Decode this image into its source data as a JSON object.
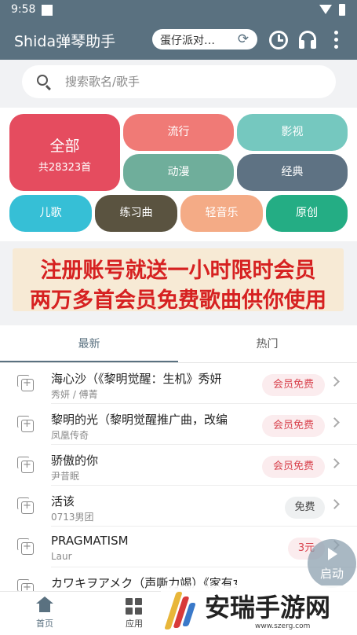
{
  "status_bar": {
    "time": "9:58"
  },
  "app_bar": {
    "title": "Shida弹琴助手",
    "current_song": "蛋仔派对…"
  },
  "search": {
    "placeholder": "搜索歌名/歌手"
  },
  "categories": {
    "all": {
      "label": "全部",
      "count": "共28323首"
    },
    "items": [
      {
        "label": "流行",
        "color": "#f07a76"
      },
      {
        "label": "影视",
        "color": "#75c8bf"
      },
      {
        "label": "动漫",
        "color": "#6fae9b"
      },
      {
        "label": "经典",
        "color": "#5e7283"
      },
      {
        "label": "儿歌",
        "color": "#36bfd6"
      },
      {
        "label": "练习曲",
        "color": "#5a5340"
      },
      {
        "label": "轻音乐",
        "color": "#f4ab86"
      },
      {
        "label": "原创",
        "color": "#24ad84"
      }
    ]
  },
  "banner": {
    "line1": "注册账号就送一小时限时会员",
    "line2": "两万多首会员免费歌曲供你使用"
  },
  "tabs": {
    "latest": "最新",
    "hot": "热门"
  },
  "songs": [
    {
      "name": "海心沙（《黎明觉醒：生机》秀妍",
      "artist": "秀妍 / 傅菁",
      "badge": "会员免费",
      "badge_type": "member"
    },
    {
      "name": "黎明的光（黎明觉醒推广曲，改编",
      "artist": "凤凰传奇",
      "badge": "会员免费",
      "badge_type": "member"
    },
    {
      "name": "骄傲的你",
      "artist": "尹昔眠",
      "badge": "会员免费",
      "badge_type": "member"
    },
    {
      "name": "活该",
      "artist": "0713男团",
      "badge": "免费",
      "badge_type": "free"
    },
    {
      "name": "PRAGMATISM",
      "artist": "Laur",
      "badge": "3元",
      "badge_type": "price"
    },
    {
      "name": "カワキヲアメク（声嘶力竭）《家有女",
      "artist": "",
      "badge": "",
      "badge_type": "none"
    }
  ],
  "fab": {
    "label": "启动"
  },
  "bottom_nav": {
    "home": "首页",
    "apps": "应用"
  },
  "watermark": {
    "name": "安瑞手游网",
    "url": "www.szerg.com"
  },
  "colors": {
    "primary": "#5a7180",
    "all_tile": "#e54c5f",
    "badge_member_text": "#d9444f",
    "banner_text": "#d62121"
  }
}
